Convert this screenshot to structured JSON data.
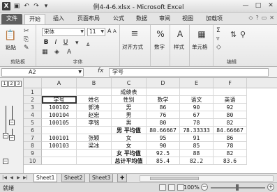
{
  "window": {
    "title": "例4-4-6.xlsx - Microsoft Excel",
    "app_icon": "X",
    "qat_icons": [
      "save-icon",
      "undo-icon",
      "redo-icon",
      "customize-qat-icon"
    ],
    "controls": [
      "—",
      "□",
      "✕"
    ]
  },
  "tabs": [
    "文件",
    "开始",
    "插入",
    "页面布局",
    "公式",
    "数据",
    "审阅",
    "视图",
    "加载项"
  ],
  "ribbon": {
    "clipboard": {
      "paste": "粘贴",
      "group": "剪贴板"
    },
    "font": {
      "name": "宋体",
      "size": "11",
      "group": "字体",
      "bold": "B",
      "italic": "I",
      "underline": "U"
    },
    "alignment": {
      "label": "对齐方式"
    },
    "number": {
      "label": "数字"
    },
    "styles": {
      "label": "样式"
    },
    "cells": {
      "label": "单元格"
    },
    "editing": {
      "group": "编辑"
    }
  },
  "formula_bar": {
    "name_box": "A2",
    "fx": "fx",
    "value": "学号"
  },
  "outline": {
    "levels": [
      "1",
      "2",
      "3"
    ]
  },
  "sheet": {
    "columns": [
      "A",
      "B",
      "C",
      "D",
      "E",
      "F"
    ],
    "rows": [
      {
        "num": "1",
        "cells": [
          "",
          "",
          "成绩表",
          "",
          "",
          ""
        ]
      },
      {
        "num": "2",
        "cells": [
          "学号",
          "姓名",
          "性别",
          "数学",
          "语文",
          "英语"
        ]
      },
      {
        "num": "3",
        "cells": [
          "100102",
          "郭涛",
          "男",
          "86",
          "90",
          "92"
        ]
      },
      {
        "num": "4",
        "cells": [
          "100104",
          "赵宏",
          "男",
          "76",
          "67",
          "80"
        ]
      },
      {
        "num": "5",
        "cells": [
          "100105",
          "李铭",
          "男",
          "80",
          "78",
          "82"
        ]
      },
      {
        "num": "6",
        "cells": [
          "",
          "",
          "男 平均值",
          "80.66667",
          "78.33333",
          "84.66667"
        ]
      },
      {
        "num": "7",
        "cells": [
          "100101",
          "张颖",
          "女",
          "95",
          "91",
          "86"
        ]
      },
      {
        "num": "8",
        "cells": [
          "100103",
          "梁冰",
          "女",
          "90",
          "85",
          "78"
        ]
      },
      {
        "num": "9",
        "cells": [
          "",
          "",
          "女 平均值",
          "92.5",
          "88",
          "82"
        ]
      },
      {
        "num": "10",
        "cells": [
          "",
          "",
          "总计平均值",
          "85.4",
          "82.2",
          "83.6"
        ]
      }
    ]
  },
  "sheet_tabs": [
    "Sheet1",
    "Sheet2",
    "Sheet3"
  ],
  "status": {
    "text": "就绪",
    "zoom": "100%",
    "minus": "−",
    "plus": "+"
  }
}
